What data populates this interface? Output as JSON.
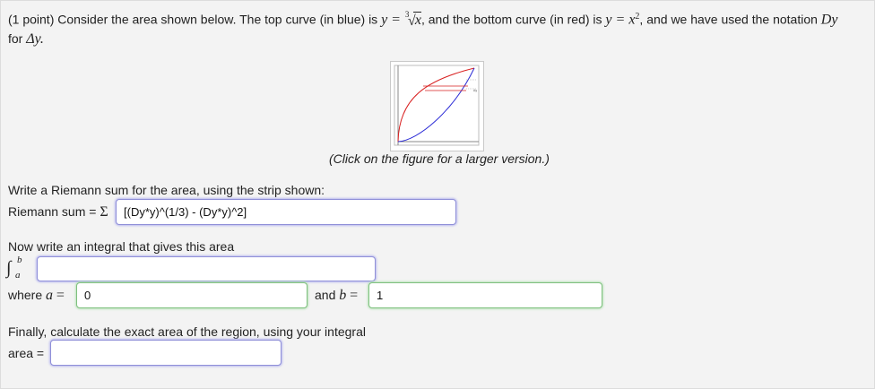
{
  "problem": {
    "intro": "(1 point) Consider the area shown below. The top curve (in blue) is",
    "top_curve_lhs": "y =",
    "top_curve_root_index": "3",
    "top_curve_radicand": "x",
    "mid": ", and the bottom curve (in red) is",
    "bottom_curve_lhs": "y = x",
    "bottom_curve_exp": "2",
    "notation_text": ", and we have used the notation",
    "notation_sym": "Dy",
    "line2_prefix": "for",
    "line2_sym": "Δy."
  },
  "figure": {
    "caption": "(Click on the figure for a larger version.)",
    "strip_label": "Δy"
  },
  "riemann": {
    "prompt": "Write a Riemann sum for the area, using the strip shown:",
    "label": "Riemann sum =",
    "sigma": "Σ",
    "value": "[(Dy*y)^(1/3) - (Dy*y)^2]"
  },
  "integral": {
    "prompt": "Now write an integral that gives this area",
    "sign": "∫",
    "upper": "b",
    "lower": "a",
    "value": "",
    "where_label": "where",
    "a_sym": "a",
    "eq": "=",
    "a_value": "0",
    "and_label": "and",
    "b_sym": "b",
    "b_value": "1"
  },
  "area": {
    "prompt": "Finally, calculate the exact area of the region, using your integral",
    "label": "area =",
    "value": ""
  },
  "colors": {
    "top_curve": "#2c2cd6",
    "bottom_curve": "#d81f1f",
    "input_blue": "#8f8fd8",
    "input_green": "#7ec07e"
  }
}
